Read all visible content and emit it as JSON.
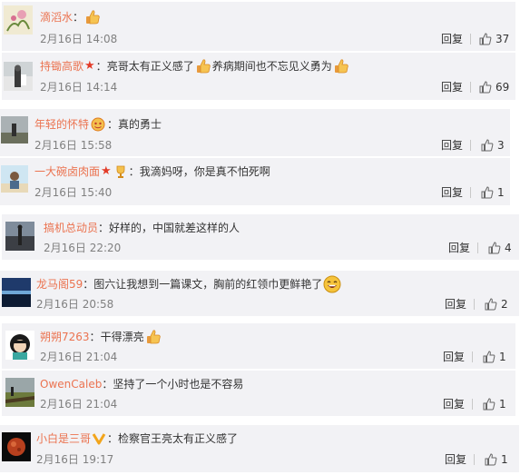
{
  "comments": [
    {
      "username": "滴滔水",
      "separator": "：",
      "text": "",
      "date": "2月16日 14:08",
      "reply_label": "回复",
      "likes": "37"
    },
    {
      "username": "持锄高歌",
      "separator": "：",
      "text": "亮哥太有正义感了",
      "text2": "养病期间也不忘见义勇为",
      "date": "2月16日 14:14",
      "reply_label": "回复",
      "likes": "69"
    },
    {
      "username": "年轻的怀特",
      "separator": "：",
      "text": "真的勇士",
      "date": "2月16日 15:58",
      "reply_label": "回复",
      "likes": "3"
    },
    {
      "username": "一大碗卤肉面",
      "separator": "：",
      "text": "我滴妈呀，你是真不怕死啊",
      "date": "2月16日 15:40",
      "reply_label": "回复",
      "likes": "1"
    },
    {
      "username": "搞机总动员",
      "separator": "：",
      "text": "好样的，中国就差这样的人",
      "date": "2月16日 22:20",
      "reply_label": "回复",
      "likes": "4"
    },
    {
      "username": "龙马阁59",
      "separator": "：",
      "text": "图六让我想到一篇课文，胸前的红领巾更鲜艳了",
      "date": "2月16日 20:58",
      "reply_label": "回复",
      "likes": "2"
    },
    {
      "username": "朔朔7263",
      "separator": "：",
      "text": "干得漂亮",
      "date": "2月16日 21:04",
      "reply_label": "回复",
      "likes": "1"
    },
    {
      "username": "OwenCaleb",
      "separator": "：",
      "text": "坚持了一个小时也是不容易",
      "date": "2月16日 21:04",
      "reply_label": "回复",
      "likes": "1"
    },
    {
      "username": "小白是三哥",
      "separator": "：",
      "text": "检察官王亮太有正义感了",
      "date": "2月16日 19:17",
      "reply_label": "回复",
      "likes": "1"
    }
  ],
  "colors": {
    "username": "#eb7350",
    "text": "#333333",
    "date": "#808080",
    "card_bg": "#f2f2f5"
  }
}
